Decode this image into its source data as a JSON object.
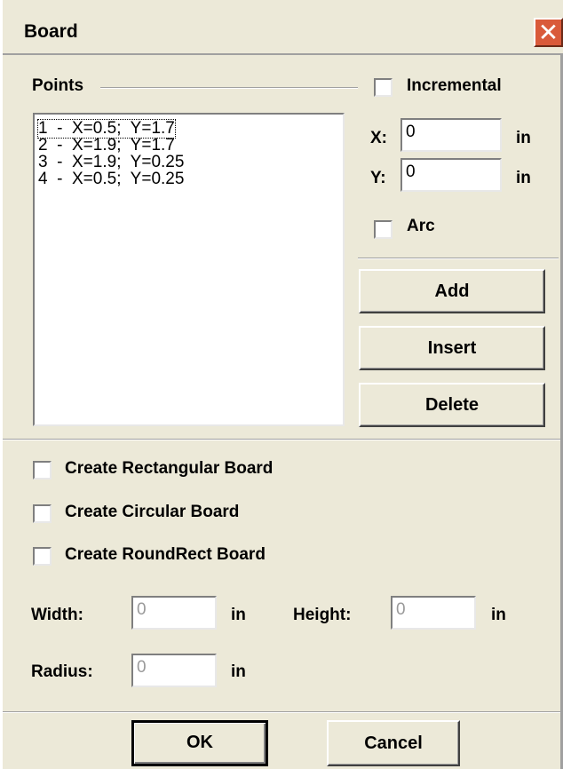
{
  "window": {
    "title": "Board"
  },
  "points_group": {
    "label": "Points"
  },
  "incremental": {
    "label": "Incremental",
    "checked": false
  },
  "points": [
    "1  -  X=0.5;  Y=1.7",
    "2  -  X=1.9;  Y=1.7",
    "3  -  X=1.9;  Y=0.25",
    "4  -  X=0.5;  Y=0.25"
  ],
  "x_field": {
    "label": "X:",
    "value": "0",
    "unit": "in"
  },
  "y_field": {
    "label": "Y:",
    "value": "0",
    "unit": "in"
  },
  "arc": {
    "label": "Arc",
    "checked": false
  },
  "buttons": {
    "add": "Add",
    "insert": "Insert",
    "delete": "Delete",
    "ok": "OK",
    "cancel": "Cancel"
  },
  "options": {
    "rectangular": "Create Rectangular Board",
    "circular": "Create Circular Board",
    "roundrect": "Create RoundRect Board"
  },
  "width_field": {
    "label": "Width:",
    "value": "0",
    "unit": "in"
  },
  "height_field": {
    "label": "Height:",
    "value": "0",
    "unit": "in"
  },
  "radius_field": {
    "label": "Radius:",
    "value": "0",
    "unit": "in"
  }
}
